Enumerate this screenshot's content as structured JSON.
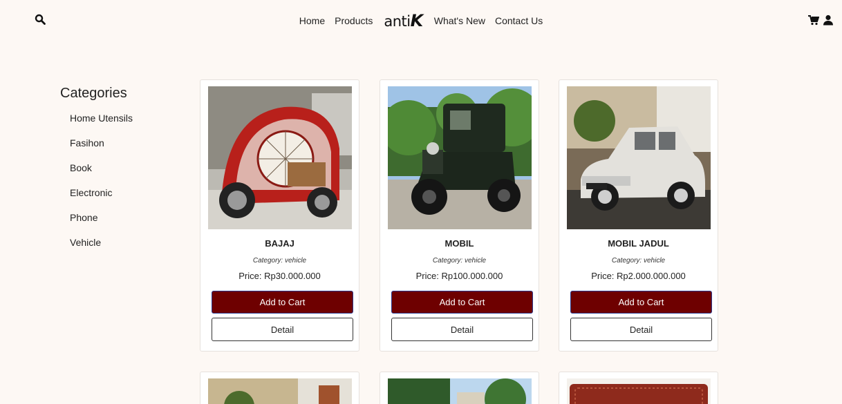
{
  "header": {
    "nav": [
      {
        "label": "Home"
      },
      {
        "label": "Products"
      },
      {
        "label": "What's New"
      },
      {
        "label": "Contact Us"
      }
    ],
    "logo": {
      "part1": "anti",
      "part2": "K"
    },
    "icons": [
      "search-icon",
      "cart-icon",
      "user-icon"
    ]
  },
  "sidebar": {
    "title": "Categories",
    "items": [
      "Home Utensils",
      "Fasihon",
      "Book",
      "Electronic",
      "Phone",
      "Vehicle"
    ]
  },
  "products": [
    {
      "name": "BAJAJ",
      "category": "Category: vehicle",
      "price": "Price: Rp30.000.000",
      "cart_label": "Add to Cart",
      "detail_label": "Detail"
    },
    {
      "name": "MOBIL",
      "category": "Category: vehicle",
      "price": "Price: Rp100.000.000",
      "cart_label": "Add to Cart",
      "detail_label": "Detail"
    },
    {
      "name": "MOBIL JADUL",
      "category": "Category: vehicle",
      "price": "Price: Rp2.000.000.000",
      "cart_label": "Add to Cart",
      "detail_label": "Detail"
    }
  ],
  "colors": {
    "background": "#fdf8f4",
    "accent": "#6e0000",
    "button_border": "#2b3a8f"
  }
}
